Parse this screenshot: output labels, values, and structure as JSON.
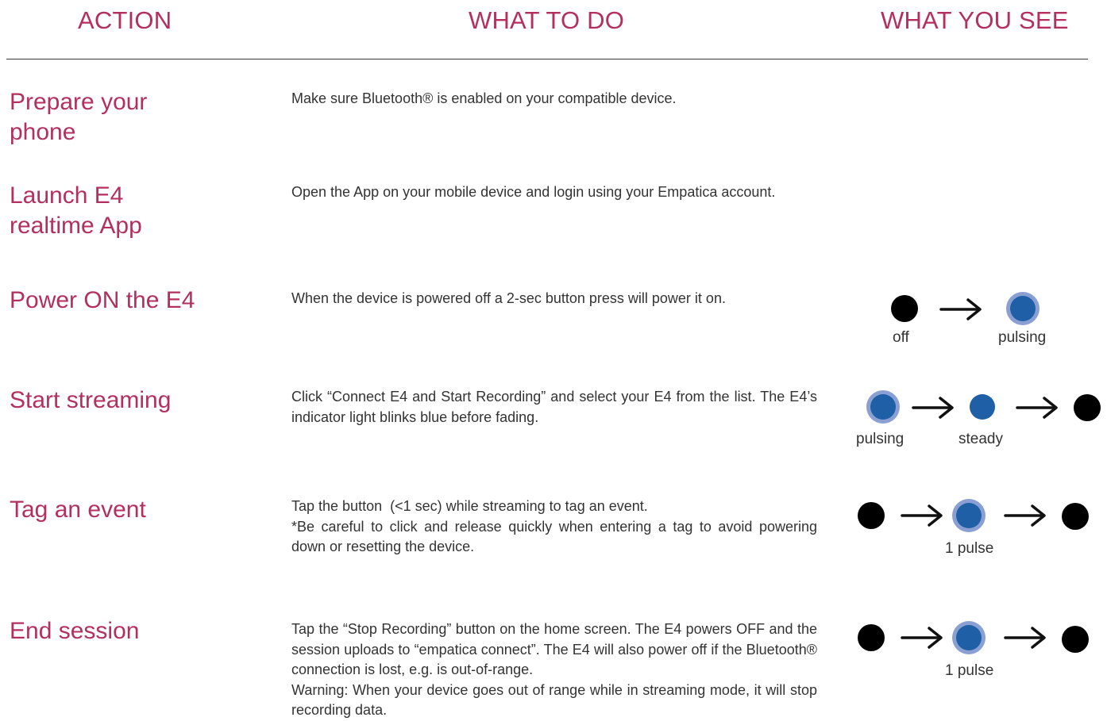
{
  "header": {
    "action": "ACTION",
    "what_to_do": "WHAT TO DO",
    "what_you_see": "WHAT YOU SEE"
  },
  "rows": [
    {
      "action": "Prepare your phone",
      "text": [
        "Make sure Bluetooth® is enabled on your compatible device."
      ]
    },
    {
      "action": "Launch E4 realtime App",
      "text": [
        "Open the App on your mobile device and login using your Empatica account."
      ]
    },
    {
      "action": "Power ON the E4",
      "text": [
        "When the device is powered off a 2-sec button press will power it on."
      ],
      "labels": [
        "off",
        "pulsing"
      ]
    },
    {
      "action": "Start streaming",
      "text": [
        "Click “Connect E4 and Start Recording” and select your E4 from the list. The E4’s indicator light blinks blue before fading."
      ],
      "labels": [
        "pulsing",
        "steady"
      ]
    },
    {
      "action": "Tag an event",
      "text": [
        "Tap the button  (<1 sec) while streaming to tag an event.",
        "*Be careful to click and release quickly when entering a tag to avoid powering down or resetting the device."
      ],
      "labels": [
        "1 pulse"
      ]
    },
    {
      "action": "End session",
      "text": [
        "Tap the “Stop Recording” button on the home screen. The E4 powers OFF and the session uploads to “empatica connect”. The E4 will also power off if the Bluetooth® connection is lost, e.g. is out-of-range.",
        "Warning: When your device goes out of range while in streaming mode, it will stop recording data."
      ],
      "labels": [
        "1 pulse"
      ]
    }
  ],
  "colors": {
    "accent": "#b3305e",
    "led_blue": "#1e5fa6",
    "led_glow": "#8ba0d2",
    "led_off": "#000000",
    "text": "#333333"
  }
}
